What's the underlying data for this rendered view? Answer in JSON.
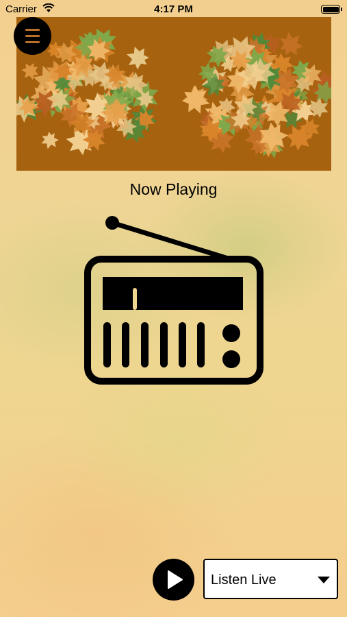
{
  "status_bar": {
    "carrier": "Carrier",
    "time": "4:17 PM"
  },
  "banner": {
    "image": "autumn-leaves-wreath"
  },
  "menu": {
    "icon": "hamburger-icon"
  },
  "player": {
    "now_playing": "Now Playing",
    "artwork_icon": "radio-icon",
    "play_icon": "play-icon",
    "stream_selected": "Listen Live"
  },
  "colors": {
    "banner_bg": "#a6620f",
    "accent": "#b8702a",
    "button_bg": "#000000"
  }
}
